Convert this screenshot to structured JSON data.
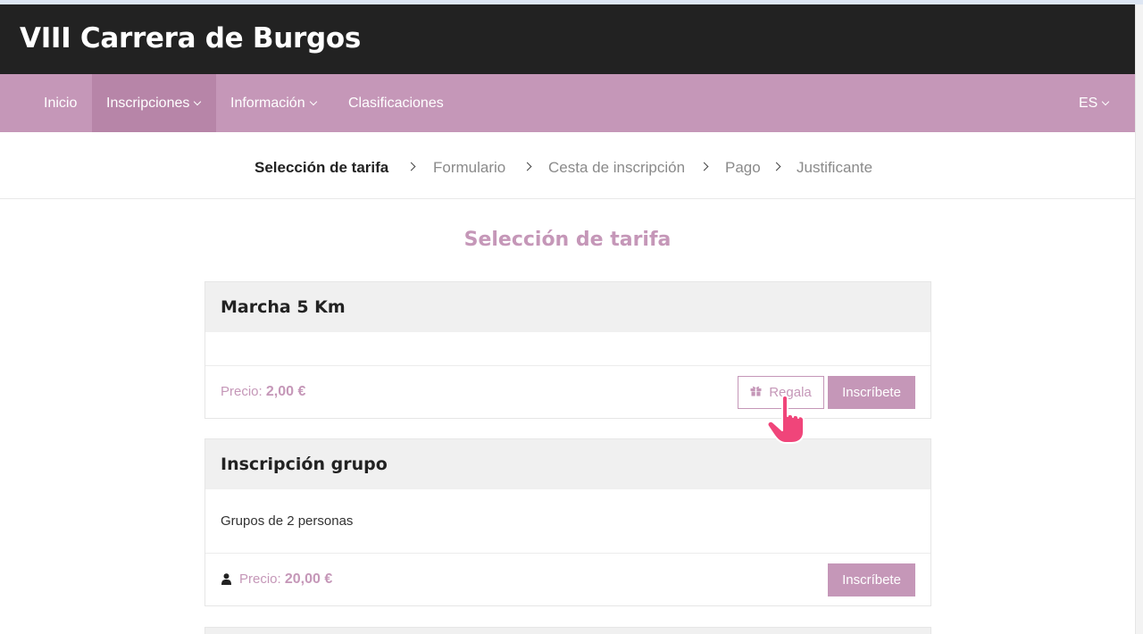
{
  "site": {
    "title": "VIII Carrera de Burgos"
  },
  "nav": {
    "items": [
      {
        "label": "Inicio"
      },
      {
        "label": "Inscripciones"
      },
      {
        "label": "Información"
      },
      {
        "label": "Clasificaciones"
      }
    ],
    "language": "ES"
  },
  "steps": [
    {
      "label": "Selección de tarifa",
      "current": true
    },
    {
      "label": "Formulario"
    },
    {
      "label": "Cesta de inscripción"
    },
    {
      "label": "Pago"
    },
    {
      "label": "Justificante"
    }
  ],
  "section_title": "Selección de tarifa",
  "rates": [
    {
      "name": "Marcha 5 Km",
      "description": "",
      "price_label": "Precio:",
      "price_value": "2,00 €",
      "gift_label": "Regala",
      "register_label": "Inscríbete"
    },
    {
      "name": "Inscripción grupo",
      "description": "Grupos de 2 personas",
      "price_label": "Precio:",
      "price_value": "20,00 €",
      "register_label": "Inscríbete"
    }
  ],
  "colors": {
    "header_bg": "#222222",
    "accent": "#c597b8",
    "nav_active": "#b785a8",
    "cursor": "#f0457a"
  },
  "icons": [
    "chevron-down-icon",
    "chevron-right-icon",
    "gift-icon",
    "user-icon",
    "hand-pointer-cursor-icon"
  ]
}
